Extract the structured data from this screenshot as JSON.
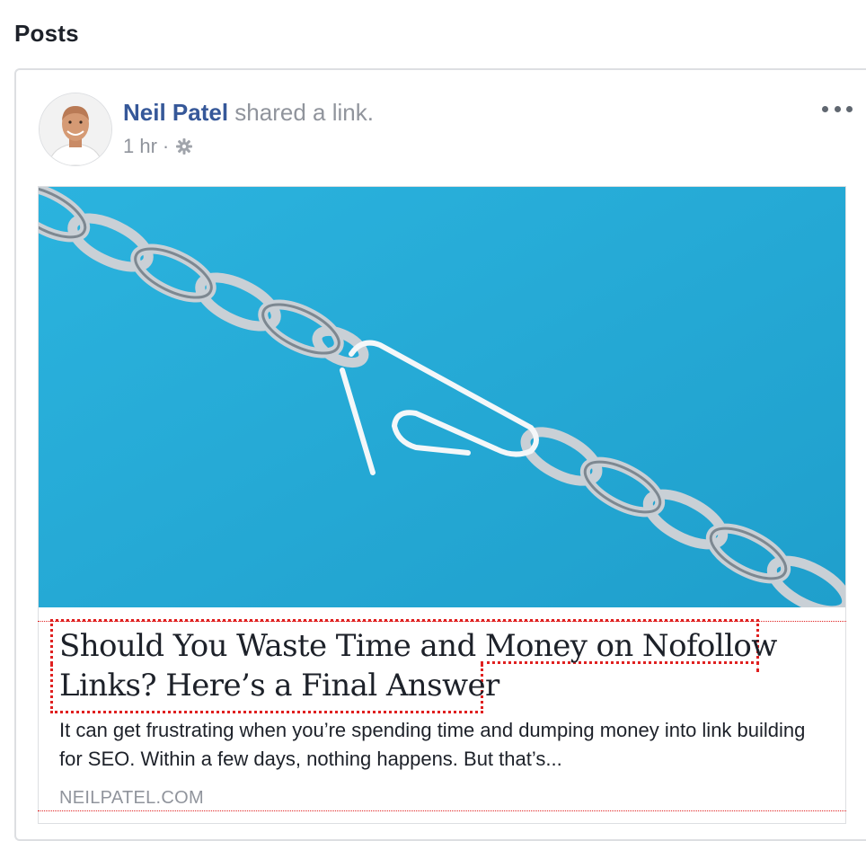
{
  "section": {
    "title": "Posts"
  },
  "post": {
    "author": "Neil Patel",
    "action": "shared a link.",
    "timestamp": "1 hr",
    "separator": "·",
    "privacy_icon": "gear-icon",
    "more_icon": "more-options-icon",
    "link": {
      "headline_line1": "Should You Waste Time and Money on Nofollow",
      "headline_line2": "Links? Here’s a Final Answer",
      "description": "It can get frustrating when you’re spending time and dumping money into link building for SEO. Within a few days, nothing happens. But that’s...",
      "domain": "NEILPATEL.COM"
    }
  },
  "colors": {
    "author": "#365899",
    "meta": "#90949c",
    "image_background": "#23a7d3",
    "annotation": "#e02020"
  }
}
